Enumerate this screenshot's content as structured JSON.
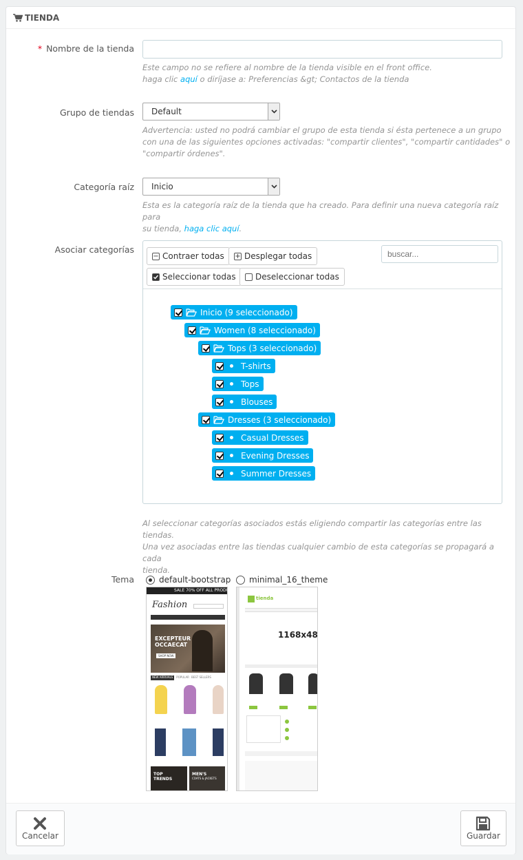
{
  "panel": {
    "title": "TIENDA"
  },
  "shop_name": {
    "required_mark": "*",
    "label": "Nombre de la tienda",
    "value": "",
    "help_line1": "Este campo no se refiere al nombre de la tienda visible en el front office.",
    "help_prefix": "haga clic ",
    "help_link": "aquí",
    "help_suffix": " o diríjase a: Preferencias &gt; Contactos de la tienda"
  },
  "shop_group": {
    "label": "Grupo de tiendas",
    "selected": "Default",
    "help_line1": "Advertencia: usted no podrá cambiar el grupo de esta tienda si ésta pertenece a un grupo",
    "help_line2": "con una de las siguientes opciones activadas: \"compartir clientes\", \"compartir cantidades\" o",
    "help_line3": "\"compartir órdenes\"."
  },
  "root_category": {
    "label": "Categoría raíz",
    "selected": "Inicio",
    "help_line1": "Esta es la categoría raíz de la tienda que ha creado. Para definir una nueva categoría raíz para",
    "help_prefix": "su tienda, ",
    "help_link": "haga clic aquí",
    "help_suffix": "."
  },
  "associate": {
    "label": "Asociar categorías",
    "collapse_all": "Contraer todas",
    "expand_all": "Desplegar todas",
    "select_all": "Seleccionar todas",
    "deselect_all": "Deseleccionar todas",
    "search_placeholder": "buscar...",
    "tree": [
      {
        "label": "Inicio (9 seleccionado)",
        "kind": "folder",
        "level": 0
      },
      {
        "label": "Women (8 seleccionado)",
        "kind": "folder",
        "level": 1
      },
      {
        "label": "Tops (3 seleccionado)",
        "kind": "folder",
        "level": 2
      },
      {
        "label": "T-shirts",
        "kind": "leaf",
        "level": 3
      },
      {
        "label": "Tops",
        "kind": "leaf",
        "level": 3
      },
      {
        "label": "Blouses",
        "kind": "leaf",
        "level": 3
      },
      {
        "label": "Dresses (3 seleccionado)",
        "kind": "folder",
        "level": 2
      },
      {
        "label": "Casual Dresses",
        "kind": "leaf",
        "level": 3
      },
      {
        "label": "Evening Dresses",
        "kind": "leaf",
        "level": 3
      },
      {
        "label": "Summer Dresses",
        "kind": "leaf",
        "level": 3
      }
    ],
    "help_line1": "Al seleccionar categorías asociados estás eligiendo compartir las categorías entre las tiendas.",
    "help_line2": "Una vez asociadas entre las tiendas cualquier cambio de esta categorías se propagará a cada",
    "help_line3": "tienda."
  },
  "theme": {
    "label": "Tema",
    "options": [
      {
        "name": "default-bootstrap",
        "checked": true
      },
      {
        "name": "minimal_16_theme",
        "checked": false
      }
    ],
    "thumb1": {
      "banner": "SALE 70% OFF ALL PRODU",
      "logo": "Fashion",
      "hero_line1": "EXCEPTEUR",
      "hero_line2": "OCCAECAT",
      "hero_btn": "SHOP NOW",
      "tab1": "NEW ARRIVALS",
      "tab2": "POPULAR",
      "tab3": "BEST SELLERS",
      "promo1_line1": "TOP",
      "promo1_line2": "TRENDS",
      "promo2_line1": "MEN'S",
      "promo2_line2": "COATS & JACKETS"
    },
    "thumb2": {
      "logo": "tienda",
      "placeholder": "1168x48"
    }
  },
  "footer": {
    "cancel": "Cancelar",
    "save": "Guardar"
  }
}
